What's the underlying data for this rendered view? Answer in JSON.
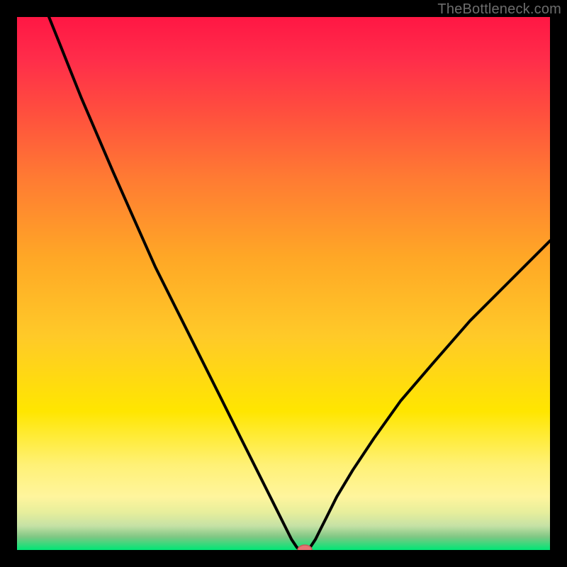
{
  "watermark": "TheBottleneck.com",
  "colors": {
    "background": "#000000",
    "grad_top": "#ff1744",
    "grad_upper_mid": "#ff5a36",
    "grad_mid": "#ffb400",
    "grad_lower_mid": "#ffe600",
    "grad_band1": "#fff59d",
    "grad_band2": "#e6ee9c",
    "grad_band3": "#aed581",
    "grad_bottom": "#00e676",
    "curve": "#000000",
    "marker_fill": "#e57373",
    "marker_stroke": "#c85a5a"
  },
  "chart_data": {
    "type": "line",
    "title": "",
    "xlabel": "",
    "ylabel": "",
    "xlim": [
      0,
      100
    ],
    "ylim": [
      0,
      100
    ],
    "x": [
      6,
      8,
      10,
      12,
      15,
      18,
      22,
      26,
      30,
      34,
      38,
      42,
      45,
      48,
      50,
      51.5,
      52.5,
      53,
      54,
      55,
      56,
      57,
      58,
      60,
      63,
      67,
      72,
      78,
      85,
      92,
      100
    ],
    "y": [
      100,
      95,
      90,
      85,
      78,
      71,
      62,
      53,
      45,
      37,
      29,
      21,
      15,
      9,
      5,
      2,
      0.5,
      0,
      0,
      0.5,
      2,
      4,
      6,
      10,
      15,
      21,
      28,
      35,
      43,
      50,
      58
    ],
    "note": "x is approximate horizontal position (0=left plot edge, 100=right plot edge); y is approximate bottleneck percentage (0 at bottom green band, 100 at top red). Minimum (optimum) at roughly x=53-55.",
    "marker": {
      "x": 54,
      "y": 0
    },
    "legend": [],
    "grid": false
  }
}
